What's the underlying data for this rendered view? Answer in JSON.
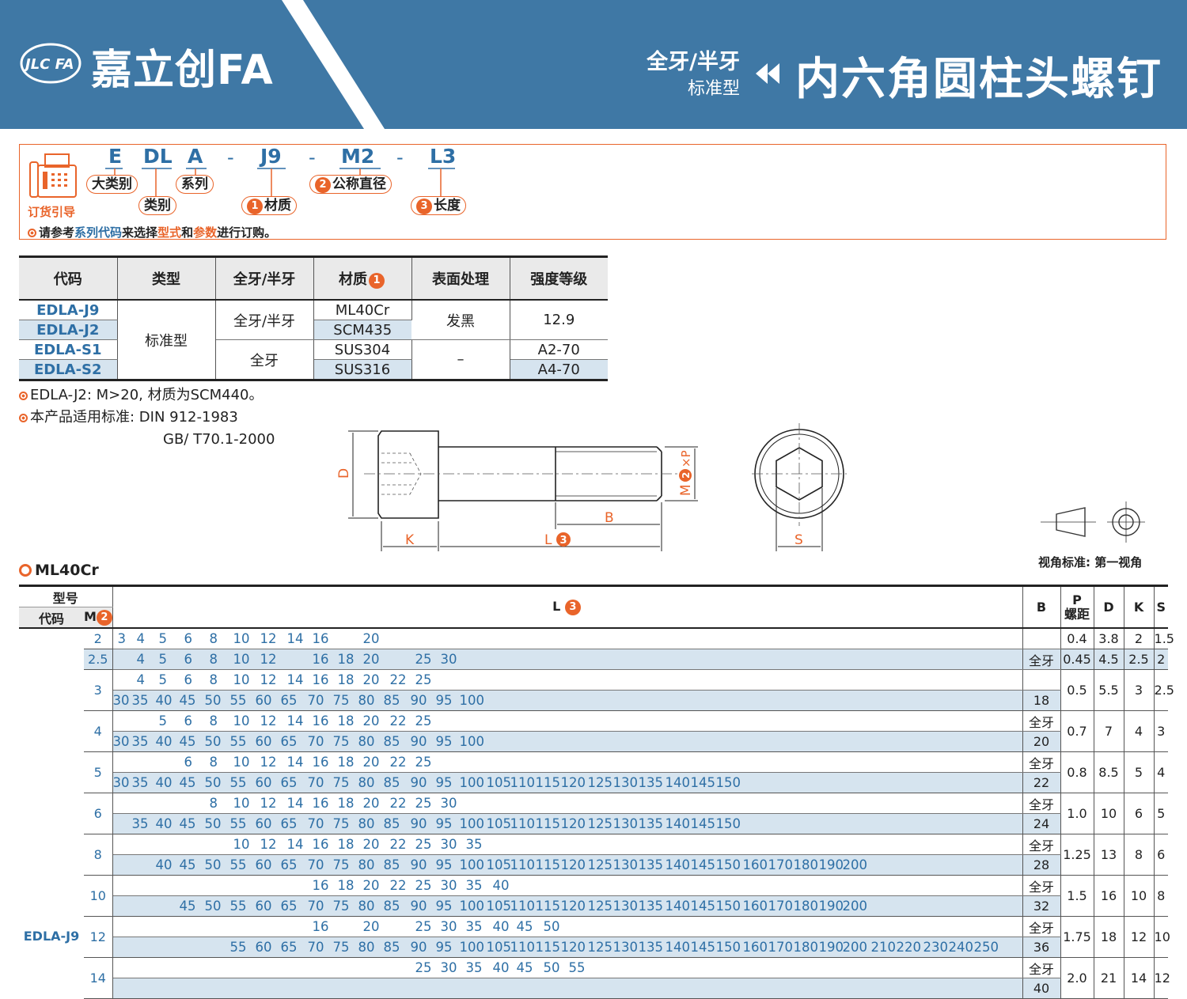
{
  "brand": {
    "logo_mark": "JLC FA",
    "name": "嘉立创FA"
  },
  "header": {
    "sub1": "全牙/半牙",
    "sub2": "标准型",
    "title": "内六角圆柱头螺钉"
  },
  "order": {
    "label": "订货引导",
    "parts": [
      "E",
      "DL",
      "A",
      "J9",
      "M2",
      "L3"
    ],
    "dash": "-",
    "pills": {
      "major": "大类别",
      "category": "类别",
      "series": "系列",
      "material": "材质",
      "diameter": "公称直径",
      "length": "长度"
    },
    "nums": [
      "1",
      "2",
      "3"
    ],
    "note": {
      "pre": "请参考",
      "link1": "系列代码",
      "mid1": "来选择",
      "link2": "型式",
      "mid2": "和",
      "link3": "参数",
      "post": "进行订购。"
    }
  },
  "spec_table": {
    "headers": [
      "代码",
      "类型",
      "全牙/半牙",
      "材质",
      "表面处理",
      "强度等级"
    ],
    "rows": [
      {
        "code": "EDLA-J9",
        "material": "ML40Cr"
      },
      {
        "code": "EDLA-J2",
        "material": "SCM435"
      },
      {
        "code": "EDLA-S1",
        "material": "SUS304"
      },
      {
        "code": "EDLA-S2",
        "material": "SUS316"
      }
    ],
    "type": "标准型",
    "thread_a": "全牙/半牙",
    "thread_b": "全牙",
    "finish_a": "发黑",
    "finish_b": "–",
    "grade_a": "12.9",
    "grade_b": "A2-70",
    "grade_c": "A4-70"
  },
  "notes": {
    "n1": "EDLA-J2: M>20, 材质为SCM440。",
    "n2": "本产品适用标准: DIN 912-1983",
    "n3": "GB/ T70.1-2000"
  },
  "drawing": {
    "D": "D",
    "K": "K",
    "L": "L",
    "B": "B",
    "M": "M",
    "P": "×P",
    "S": "S",
    "num_l": "3",
    "num_m": "2"
  },
  "view_label": "视角标准: 第一视角",
  "ml": {
    "title": "ML40Cr",
    "h_model": "型号",
    "h_code": "代码",
    "h_m": "M",
    "h_l": "L",
    "h_b": "B",
    "h_p": "P",
    "h_p2": "螺距",
    "h_d": "D",
    "h_k": "K",
    "h_s": "S",
    "code": "EDLA-J9",
    "full": "全牙",
    "rows": [
      {
        "m": "2",
        "l1": [
          "3",
          "4",
          "5",
          "6",
          "8",
          "10",
          "12",
          "14",
          "16",
          "20"
        ],
        "b1": "",
        "p": "0.4",
        "d": "3.8",
        "k": "2",
        "s": "1.5"
      },
      {
        "m": "2.5",
        "l1": [
          "4",
          "5",
          "6",
          "8",
          "10",
          "12",
          "16",
          "18",
          "20",
          "25",
          "30"
        ],
        "b1": "全牙",
        "p": "0.45",
        "d": "4.5",
        "k": "2.5",
        "s": "2"
      },
      {
        "m": "3",
        "l1": [
          "4",
          "5",
          "6",
          "8",
          "10",
          "12",
          "14",
          "16",
          "18",
          "20",
          "22",
          "25"
        ],
        "l2": [
          "30",
          "35",
          "40",
          "45",
          "50",
          "55",
          "60",
          "65",
          "70",
          "75",
          "80",
          "85",
          "90",
          "95",
          "100"
        ],
        "b1": "",
        "b2": "18",
        "p": "0.5",
        "d": "5.5",
        "k": "3",
        "s": "2.5"
      },
      {
        "m": "4",
        "l1": [
          "5",
          "6",
          "8",
          "10",
          "12",
          "14",
          "16",
          "18",
          "20",
          "22",
          "25"
        ],
        "l2": [
          "30",
          "35",
          "40",
          "45",
          "50",
          "55",
          "60",
          "65",
          "70",
          "75",
          "80",
          "85",
          "90",
          "95",
          "100"
        ],
        "b1": "全牙",
        "b2": "20",
        "p": "0.7",
        "d": "7",
        "k": "4",
        "s": "3"
      },
      {
        "m": "5",
        "l1": [
          "6",
          "8",
          "10",
          "12",
          "14",
          "16",
          "18",
          "20",
          "22",
          "25"
        ],
        "l2": [
          "30",
          "35",
          "40",
          "45",
          "50",
          "55",
          "60",
          "65",
          "70",
          "75",
          "80",
          "85",
          "90",
          "95",
          "100",
          "105",
          "110",
          "115",
          "120",
          "125",
          "130",
          "135",
          "140",
          "145",
          "150"
        ],
        "b1": "全牙",
        "b2": "22",
        "p": "0.8",
        "d": "8.5",
        "k": "5",
        "s": "4"
      },
      {
        "m": "6",
        "l1": [
          "8",
          "10",
          "12",
          "14",
          "16",
          "18",
          "20",
          "22",
          "25",
          "30"
        ],
        "l2": [
          "35",
          "40",
          "45",
          "50",
          "55",
          "60",
          "65",
          "70",
          "75",
          "80",
          "85",
          "90",
          "95",
          "100",
          "105",
          "110",
          "115",
          "120",
          "125",
          "130",
          "135",
          "140",
          "145",
          "150"
        ],
        "b1": "全牙",
        "b2": "24",
        "p": "1.0",
        "d": "10",
        "k": "6",
        "s": "5"
      },
      {
        "m": "8",
        "l1": [
          "10",
          "12",
          "14",
          "16",
          "18",
          "20",
          "22",
          "25",
          "30",
          "35"
        ],
        "l2": [
          "40",
          "45",
          "50",
          "55",
          "60",
          "65",
          "70",
          "75",
          "80",
          "85",
          "90",
          "95",
          "100",
          "105",
          "110",
          "115",
          "120",
          "125",
          "130",
          "135",
          "140",
          "145",
          "150",
          "160",
          "170",
          "180",
          "190",
          "200"
        ],
        "b1": "全牙",
        "b2": "28",
        "p": "1.25",
        "d": "13",
        "k": "8",
        "s": "6"
      },
      {
        "m": "10",
        "l1": [
          "16",
          "18",
          "20",
          "22",
          "25",
          "30",
          "35",
          "40"
        ],
        "l2": [
          "45",
          "50",
          "55",
          "60",
          "65",
          "70",
          "75",
          "80",
          "85",
          "90",
          "95",
          "100",
          "105",
          "110",
          "115",
          "120",
          "125",
          "130",
          "135",
          "140",
          "145",
          "150",
          "160",
          "170",
          "180",
          "190",
          "200"
        ],
        "b1": "全牙",
        "b2": "32",
        "p": "1.5",
        "d": "16",
        "k": "10",
        "s": "8"
      },
      {
        "m": "12",
        "l1": [
          "16",
          "20",
          "25",
          "30",
          "35",
          "40",
          "45",
          "50"
        ],
        "l2": [
          "55",
          "60",
          "65",
          "70",
          "75",
          "80",
          "85",
          "90",
          "95",
          "100",
          "105",
          "110",
          "115",
          "120",
          "125",
          "130",
          "135",
          "140",
          "145",
          "150",
          "160",
          "170",
          "180",
          "190",
          "200",
          "210",
          "220",
          "230",
          "240",
          "250"
        ],
        "b1": "全牙",
        "b2": "36",
        "p": "1.75",
        "d": "18",
        "k": "12",
        "s": "10"
      },
      {
        "m": "14",
        "l1": [
          "25",
          "30",
          "35",
          "40",
          "45",
          "50",
          "55"
        ],
        "l2": [],
        "b1": "全牙",
        "b2": "40",
        "p": "2.0",
        "d": "21",
        "k": "14",
        "s": "12"
      }
    ]
  }
}
